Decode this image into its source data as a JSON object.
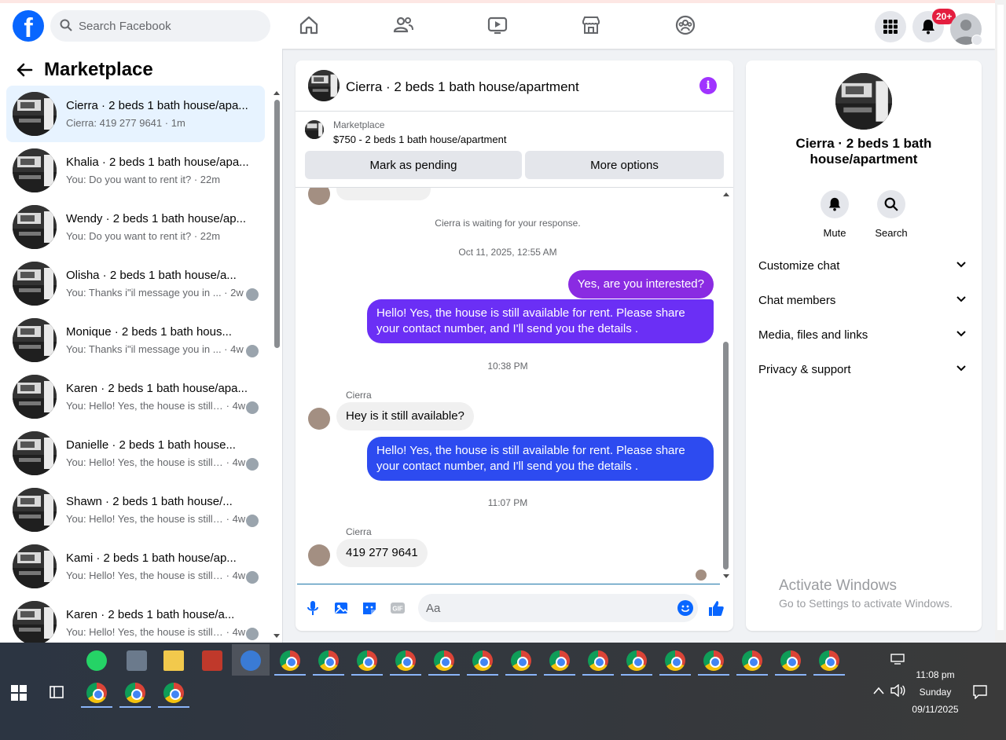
{
  "search": {
    "placeholder": "Search Facebook"
  },
  "nav": {
    "badge": "20+"
  },
  "sidebar": {
    "title": "Marketplace",
    "conversations": [
      {
        "title": "Cierra · 2 beds 1 bath house/apa...",
        "snippet": "Cierra: 419 277 9641",
        "time": "1m",
        "active": true
      },
      {
        "title": "Khalia · 2 beds 1 bath house/apa...",
        "snippet": "You: Do you want to rent it?",
        "time": "22m"
      },
      {
        "title": "Wendy · 2 beds 1 bath house/ap...",
        "snippet": "You: Do you want to rent it?",
        "time": "22m"
      },
      {
        "title": "Olisha · 2 beds 1 bath house/a...",
        "snippet": "You: Thanks i\"il message you in ...",
        "time": "2w"
      },
      {
        "title": "Monique · 2 beds 1 bath hous...",
        "snippet": "You: Thanks i\"il message you in ...",
        "time": "4w"
      },
      {
        "title": "Karen · 2 beds 1 bath house/apa...",
        "snippet": "You: Hello! Yes, the house is still av...",
        "time": "4w"
      },
      {
        "title": "Danielle · 2 beds 1 bath house...",
        "snippet": "You: Hello! Yes, the house is still ...",
        "time": "4w"
      },
      {
        "title": "Shawn · 2 beds 1 bath house/...",
        "snippet": "You: Hello! Yes, the house is still ...",
        "time": "4w"
      },
      {
        "title": "Kami · 2 beds 1 bath house/ap...",
        "snippet": "You: Hello! Yes, the house is still ...",
        "time": "4w"
      },
      {
        "title": "Karen · 2 beds 1 bath house/a...",
        "snippet": "You: Hello! Yes, the house is still ...",
        "time": "4w"
      }
    ]
  },
  "chat": {
    "title": "Cierra · 2 beds 1 bath house/apartment",
    "marketplace_label": "Marketplace",
    "listing": "$750 - 2 beds 1 bath house/apartment",
    "mark_pending": "Mark as pending",
    "more_options": "More options",
    "waiting": "Cierra is waiting for your response.",
    "ts1": "Oct 11, 2025, 12:55 AM",
    "out1": "Yes, are you interested?",
    "out2": "Hello! Yes, the house is still available for rent. Please share your contact number, and I'll send you the details .",
    "ts2": "10:38 PM",
    "sender1": "Cierra",
    "in1": "Hey is it still available?",
    "out3": "Hello! Yes, the house is still available for rent. Please share your contact number, and I'll send you the details .",
    "ts3": "11:07 PM",
    "sender2": "Cierra",
    "in2": "419 277 9641",
    "composer_placeholder": "Aa",
    "colors": {
      "out_purple": "#8a2be2",
      "out_violet": "#6b2ff5",
      "out_blue": "#2d4bf0"
    }
  },
  "details": {
    "title": "Cierra · 2 beds 1 bath house/apartment",
    "mute": "Mute",
    "search": "Search",
    "sections": [
      "Customize chat",
      "Chat members",
      "Media, files and links",
      "Privacy & support"
    ]
  },
  "windows": {
    "activate_title": "Activate Windows",
    "activate_sub": "Go to Settings to activate Windows.",
    "time": "11:08 pm",
    "day": "Sunday",
    "date": "09/11/2025"
  }
}
